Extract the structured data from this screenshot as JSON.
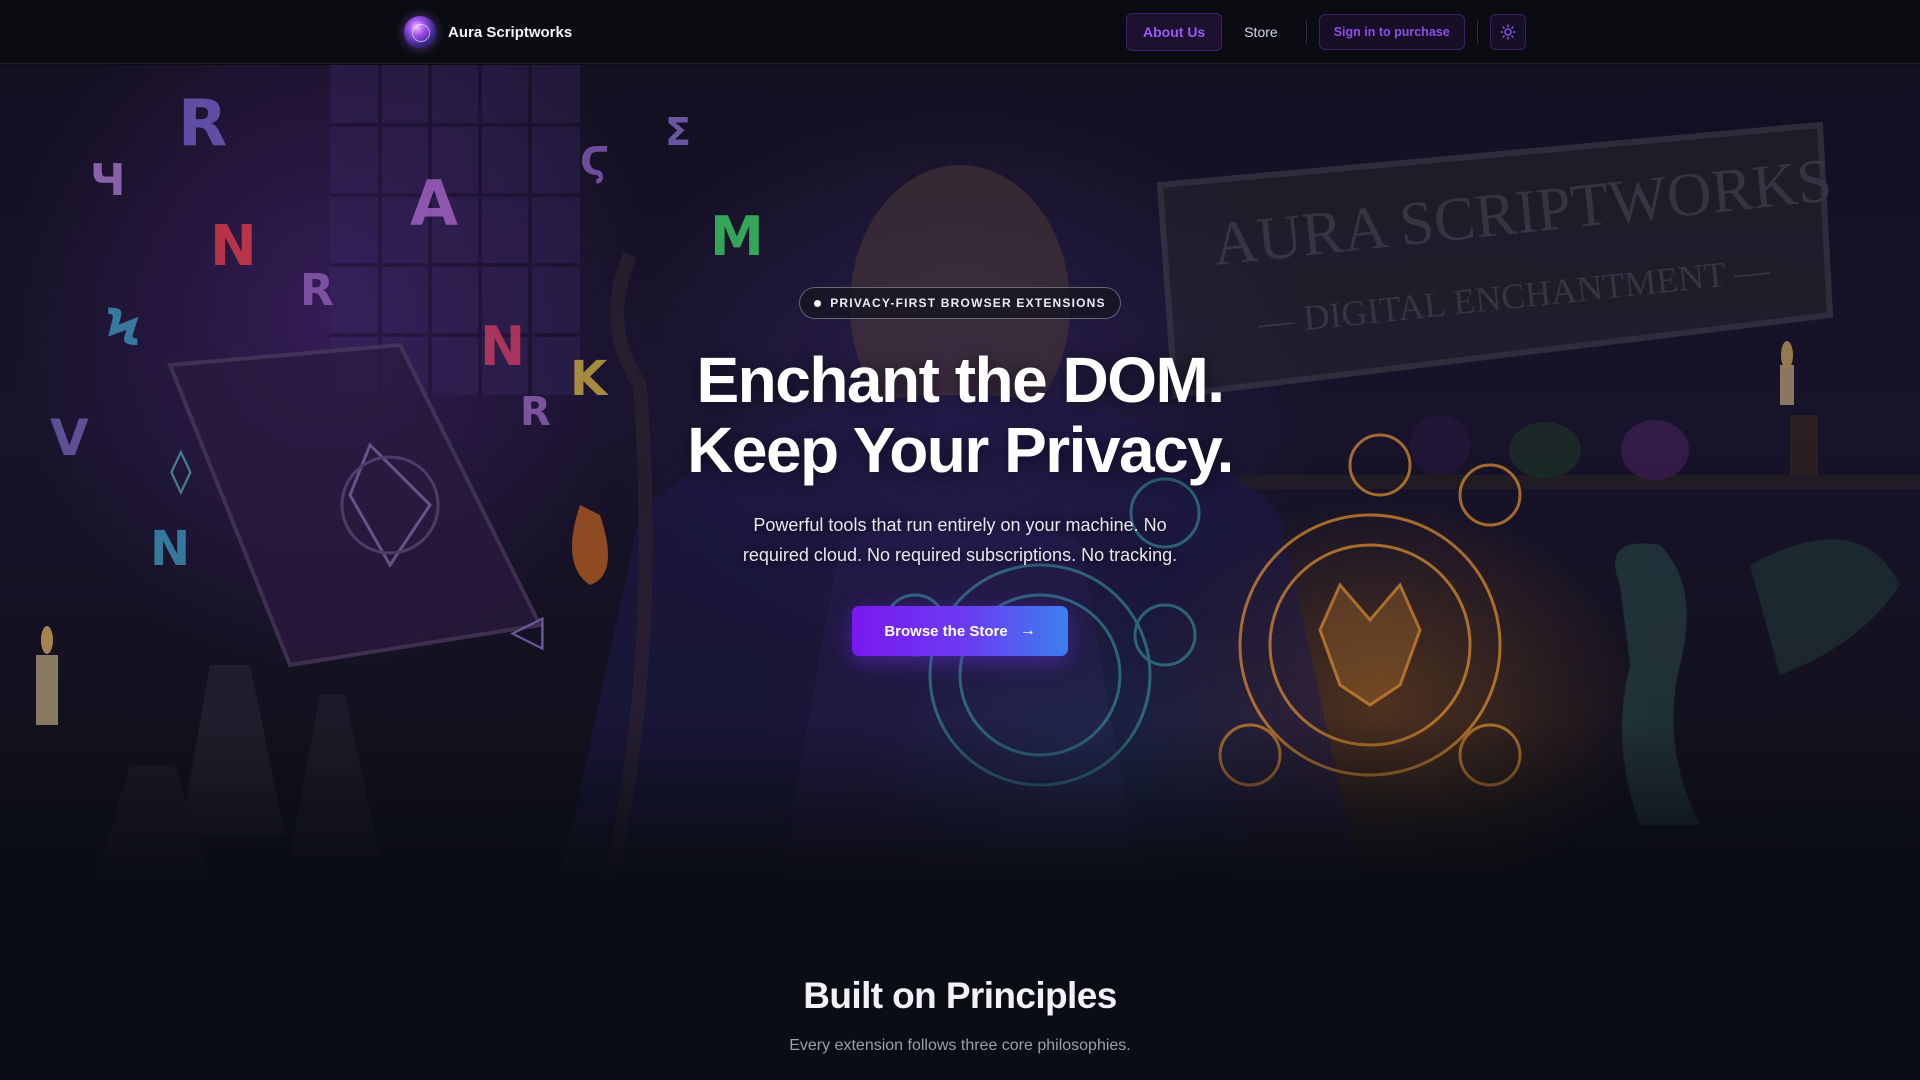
{
  "nav": {
    "brand": "Aura Scriptworks",
    "about_label": "About Us",
    "store_label": "Store",
    "signin_label": "Sign in to purchase",
    "theme_icon": "sun-icon"
  },
  "hero": {
    "badge": "PRIVACY-FIRST BROWSER EXTENSIONS",
    "headline_line1": "Enchant the DOM.",
    "headline_line2": "Keep Your Privacy.",
    "subtitle": "Powerful tools that run entirely on your machine. No required cloud. No required subscriptions. No tracking.",
    "cta_label": "Browse the Store",
    "cta_icon": "arrow-right-icon",
    "sign_text_line1": "AURA SCRIPTWORKS",
    "sign_text_line2": "— DIGITAL ENCHANTMENT —"
  },
  "principles": {
    "title": "Built on Principles",
    "subtitle": "Every extension follows three core philosophies."
  },
  "colors": {
    "accent": "#9b59f5",
    "cta_start": "#7a18f0",
    "cta_end": "#3a7ff0",
    "background": "#0b0d14"
  }
}
